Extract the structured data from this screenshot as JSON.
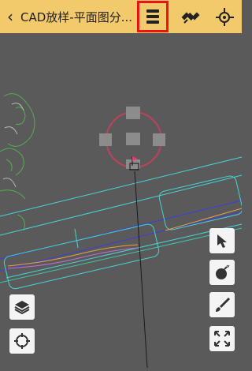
{
  "header": {
    "back_label": "‹",
    "title": "CAD放样-平面图分..."
  },
  "icons": {
    "back": "chevron-left-icon",
    "menu": "menu-list-icon",
    "satellite": "satellite-icon",
    "location": "target-location-icon",
    "layers": "layers-icon",
    "locate": "crosshair-icon",
    "select": "cursor-arrow-icon",
    "bomb": "bomb-icon",
    "draw": "brush-icon",
    "fit": "fullscreen-icon"
  },
  "colors": {
    "header_bg": "#f2c96b",
    "canvas_bg": "#5a5a5a",
    "highlight": "#e8141a",
    "cyan_line": "#46d5d5",
    "blue_line": "#3d3ddf",
    "target_ring": "#c0415a"
  }
}
